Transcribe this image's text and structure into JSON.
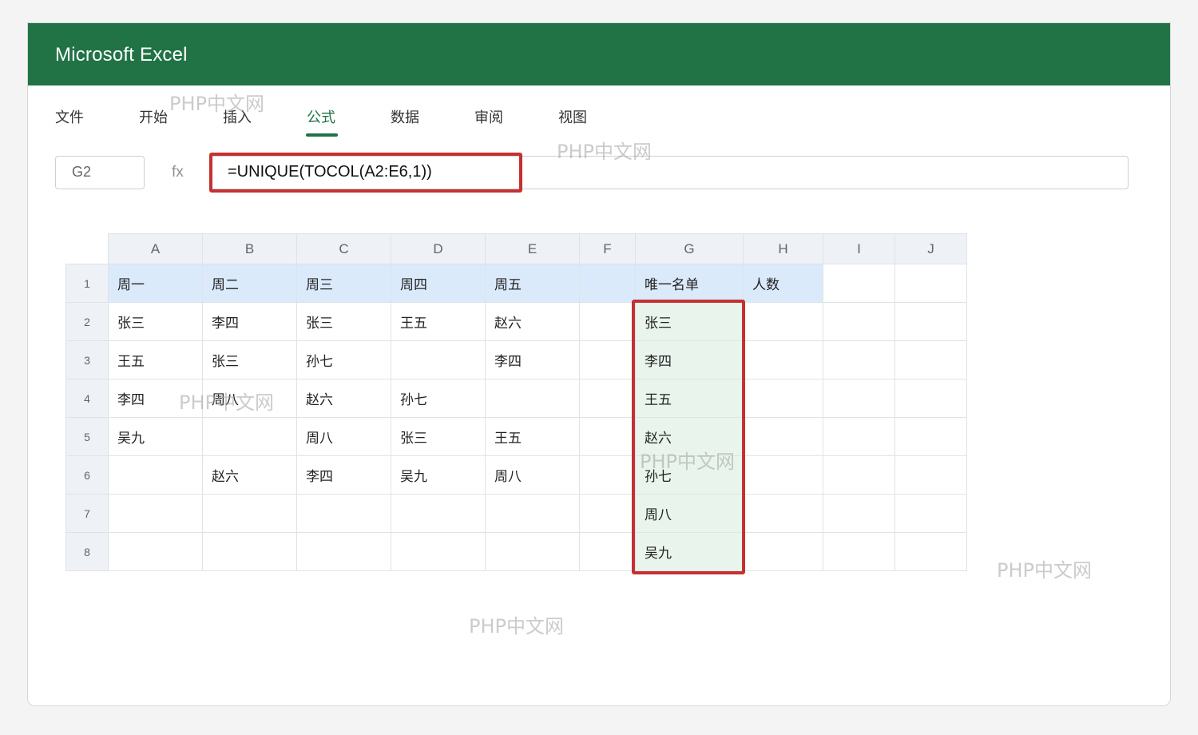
{
  "app": {
    "title": "Microsoft Excel"
  },
  "ribbon": {
    "tabs": [
      {
        "label": "文件"
      },
      {
        "label": "开始"
      },
      {
        "label": "插入"
      },
      {
        "label": "公式",
        "active": true
      },
      {
        "label": "数据"
      },
      {
        "label": "审阅"
      },
      {
        "label": "视图"
      }
    ]
  },
  "formula": {
    "name_box": "G2",
    "fx_label": "fx",
    "value": "=UNIQUE(TOCOL(A2:E6,1))"
  },
  "sheet": {
    "columns": [
      "A",
      "B",
      "C",
      "D",
      "E",
      "F",
      "G",
      "H",
      "I",
      "J"
    ],
    "rows": [
      {
        "num": "1",
        "cells": [
          "周一",
          "周二",
          "周三",
          "周四",
          "周五",
          "",
          "唯一名单",
          "人数",
          "",
          ""
        ]
      },
      {
        "num": "2",
        "cells": [
          "张三",
          "李四",
          "张三",
          "王五",
          "赵六",
          "",
          "张三",
          "",
          "",
          ""
        ]
      },
      {
        "num": "3",
        "cells": [
          "王五",
          "张三",
          "孙七",
          "",
          "李四",
          "",
          "李四",
          "",
          "",
          ""
        ]
      },
      {
        "num": "4",
        "cells": [
          "李四",
          "周八",
          "赵六",
          "孙七",
          "",
          "",
          "王五",
          "",
          "",
          ""
        ]
      },
      {
        "num": "5",
        "cells": [
          "吴九",
          "",
          "周八",
          "张三",
          "王五",
          "",
          "赵六",
          "",
          "",
          ""
        ]
      },
      {
        "num": "6",
        "cells": [
          "",
          "赵六",
          "李四",
          "吴九",
          "周八",
          "",
          "孙七",
          "",
          "",
          ""
        ]
      },
      {
        "num": "7",
        "cells": [
          "",
          "",
          "",
          "",
          "",
          "",
          "周八",
          "",
          "",
          ""
        ]
      },
      {
        "num": "8",
        "cells": [
          "",
          "",
          "",
          "",
          "",
          "",
          "吴九",
          "",
          "",
          ""
        ]
      }
    ]
  },
  "watermark": {
    "text": "PHP中文网"
  },
  "colors": {
    "brand_green": "#217346",
    "highlight_red": "#c6302f",
    "header_fill": "#dbeafb",
    "result_fill": "#e9f5ec"
  }
}
